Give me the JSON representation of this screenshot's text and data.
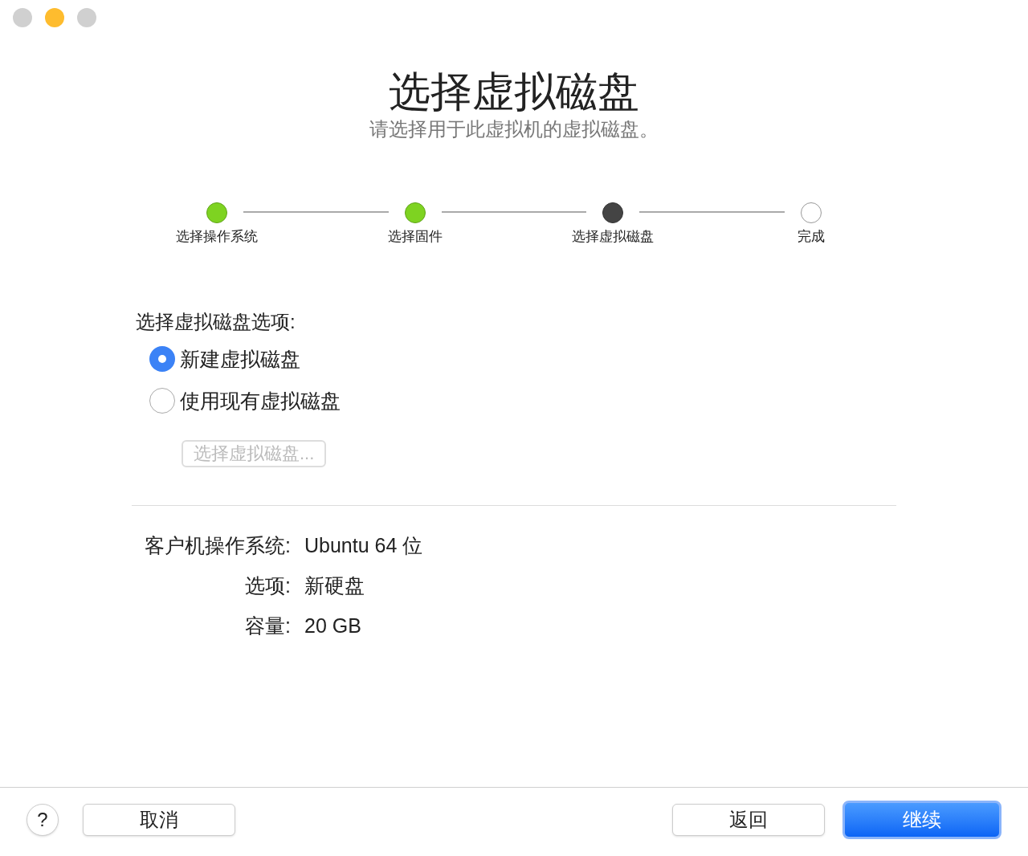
{
  "window": {
    "controls": [
      {
        "color": "#d0d0d0"
      },
      {
        "color": "#febc2e"
      },
      {
        "color": "#d0d0d0"
      }
    ]
  },
  "header": {
    "title": "选择虚拟磁盘",
    "subtitle": "请选择用于此虚拟机的虚拟磁盘。"
  },
  "steps": [
    {
      "label": "选择操作系统",
      "kind": "done"
    },
    {
      "label": "选择固件",
      "kind": "done"
    },
    {
      "label": "选择虚拟磁盘",
      "kind": "current"
    },
    {
      "label": "完成",
      "kind": "pending"
    }
  ],
  "options": {
    "label": "选择虚拟磁盘选项:",
    "radios": [
      {
        "label": "新建虚拟磁盘",
        "selected": true
      },
      {
        "label": "使用现有虚拟磁盘",
        "selected": false
      }
    ],
    "choose_button": {
      "label": "选择虚拟磁盘...",
      "disabled": true
    }
  },
  "summary": [
    {
      "label": "客户机操作系统:",
      "value": "Ubuntu 64 位"
    },
    {
      "label": "选项:",
      "value": "新硬盘"
    },
    {
      "label": "容量:",
      "value": "20 GB"
    }
  ],
  "footer": {
    "help": "?",
    "cancel": "取消",
    "back": "返回",
    "continue": "继续"
  }
}
